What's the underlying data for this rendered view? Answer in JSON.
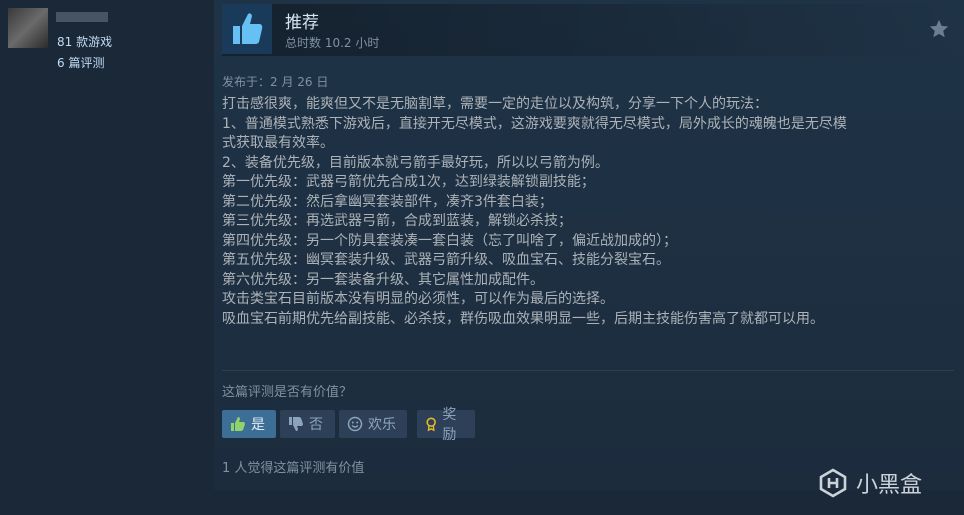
{
  "user": {
    "games_count": "81 款游戏",
    "reviews_count": "6 篇评测"
  },
  "review": {
    "verdict": "推荐",
    "hours": "总时数 10.2 小时",
    "posted": "发布于：2 月 26 日",
    "lines": [
      "打击感很爽，能爽但又不是无脑割草，需要一定的走位以及构筑，分享一下个人的玩法：",
      "1、普通模式熟悉下游戏后，直接开无尽模式，这游戏要爽就得无尽模式，局外成长的魂魄也是无尽模",
      "式获取最有效率。",
      "2、装备优先级，目前版本就弓箭手最好玩，所以以弓箭为例。",
      "第一优先级：武器弓箭优先合成1次，达到绿装解锁副技能；",
      "第二优先级：然后拿幽冥套装部件，凑齐3件套白装；",
      "第三优先级：再选武器弓箭，合成到蓝装，解锁必杀技；",
      "第四优先级：另一个防具套装凑一套白装（忘了叫啥了，偏近战加成的）；",
      "第五优先级：幽冥套装升级、武器弓箭升级、吸血宝石、技能分裂宝石。",
      "第六优先级：另一套装备升级、其它属性加成配件。",
      "攻击类宝石目前版本没有明显的必须性，可以作为最后的选择。",
      "吸血宝石前期优先给副技能、必杀技，群伤吸血效果明显一些，后期主技能伤害高了就都可以用。"
    ]
  },
  "feedback": {
    "question": "这篇评测是否有价值？",
    "yes": "是",
    "no": "否",
    "funny": "欢乐",
    "award": "奖励",
    "found_helpful": "1 人觉得这篇评测有价值"
  },
  "watermark": {
    "text": "小黑盒"
  },
  "colors": {
    "background": "#1b2838",
    "active_button": "#3c6e96",
    "button": "#2d4057",
    "thumb_icon": "#66c0f4",
    "award_icon": "#e8b628"
  }
}
